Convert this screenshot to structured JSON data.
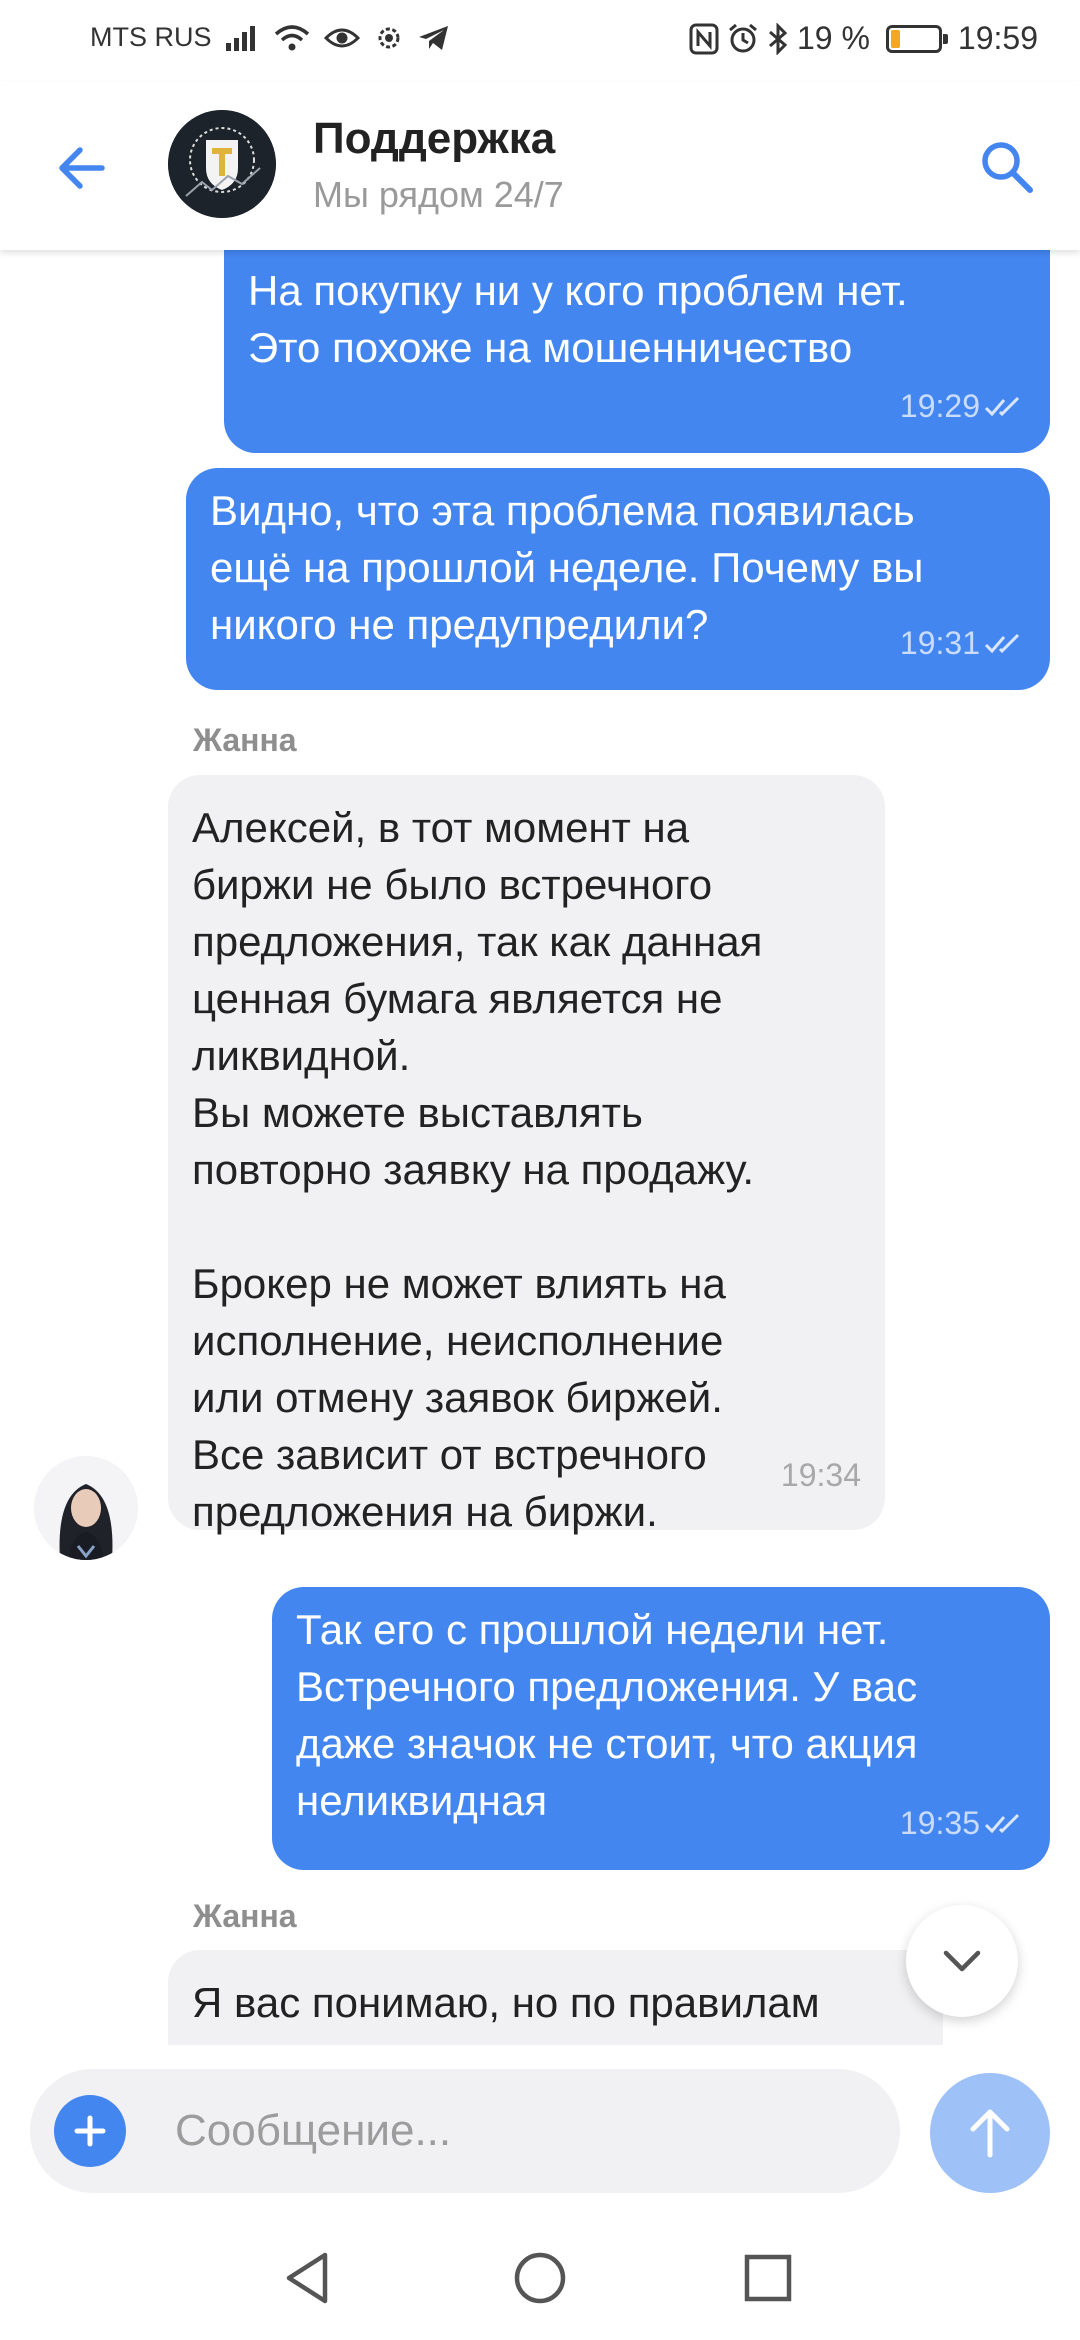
{
  "status_bar": {
    "carrier": "MTS RUS",
    "battery_percent": "19 %",
    "battery_level": 0.19,
    "time": "19:59"
  },
  "header": {
    "title": "Поддержка",
    "subtitle": "Мы рядом 24/7"
  },
  "messages": [
    {
      "text": "На покупку ни у кого проблем нет.\nЭто похоже на мошенничество",
      "time": "19:29"
    },
    {
      "text": "Видно, что эта проблема появилась\nещё на прошлой неделе. Почему вы\nникого не предупредили?",
      "time": "19:31"
    },
    {
      "sender": "Жанна"
    },
    {
      "text": "Алексей, в тот момент на\nбиржи не было встречного\nпредложения, так как данная\nценная бумага является не\nликвидной.\nВы можете выставлять\nповторно заявку на продажу.\n\nБрокер не может влиять на\nисполнение, неисполнение\nили отмену заявок биржей.\nВсе зависит от встречного\nпредложения на биржи.",
      "time": "19:34"
    },
    {
      "text": "Так его с прошлой недели нет.\nВстречного предложения. У вас\nдаже значок не стоит, что акция\nнеликвидная",
      "time": "19:35"
    },
    {
      "sender": "Жанна"
    },
    {
      "text": "Я вас понимаю, но по правилам"
    }
  ],
  "composer": {
    "placeholder": "Сообщение..."
  },
  "colors": {
    "accent": "#4486f0",
    "incoming_bubble": "#f1f1f3",
    "send_disabled": "#9ec1f7"
  }
}
